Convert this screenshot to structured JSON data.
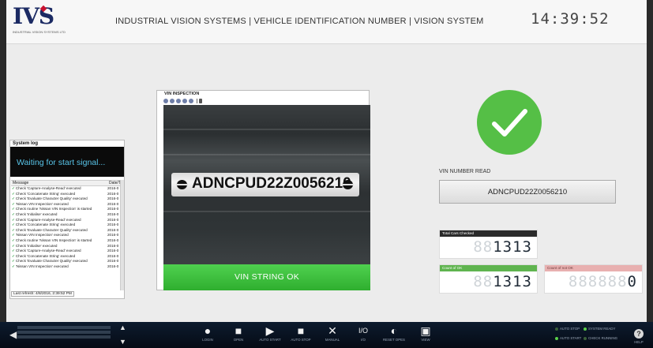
{
  "header": {
    "logo_text": "IVS",
    "logo_subtitle": "INDUSTRIAL VISION SYSTEMS LTD",
    "title": "INDUSTRIAL VISION SYSTEMS | VEHICLE IDENTIFICATION NUMBER | VISION SYSTEM",
    "clock": "14:39:52"
  },
  "system_log": {
    "title": "System log",
    "status": "Waiting for start signal...",
    "columns": [
      "Message",
      "Date/T"
    ],
    "rows": [
      {
        "msg": "Check 'Capture-Analyse-Read' executed",
        "date": "2016-0"
      },
      {
        "msg": "Check 'Concatenate String' executed",
        "date": "2016-0"
      },
      {
        "msg": "Check 'Evaluate Character Quality' executed",
        "date": "2016-0"
      },
      {
        "msg": "'Nissan VIN Inspection' executed",
        "date": "2016-0"
      },
      {
        "msg": "Check routine 'Nissan VIN Inspection' is started",
        "date": "2016-0"
      },
      {
        "msg": "Check 'Initialise' executed",
        "date": "2016-0"
      },
      {
        "msg": "Check 'Capture-Analyse-Read' executed",
        "date": "2016-0"
      },
      {
        "msg": "Check 'Concatenate String' executed",
        "date": "2016-0"
      },
      {
        "msg": "Check 'Evaluate Character Quality' executed",
        "date": "2016-0"
      },
      {
        "msg": "'Nissan VIN Inspection' executed",
        "date": "2016-0"
      },
      {
        "msg": "Check routine 'Nissan VIN Inspection' is started",
        "date": "2016-0"
      },
      {
        "msg": "Check 'Initialise' executed",
        "date": "2016-0"
      },
      {
        "msg": "Check 'Capture-Analyse-Read' executed",
        "date": "2016-0"
      },
      {
        "msg": "Check 'Concatenate String' executed",
        "date": "2016-0"
      },
      {
        "msg": "Check 'Evaluate Character Quality' executed",
        "date": "2016-0"
      },
      {
        "msg": "'Nissan VIN Inspection' executed",
        "date": "2016-0"
      }
    ],
    "footer": "Last refresh: 4/8/2016, 2:39:52 PM"
  },
  "vin_inspection": {
    "title": "VIN INSPECTION",
    "plate_text": "ADNCPUD22Z0056210",
    "result": "VIN STRING OK"
  },
  "vin_read": {
    "label": "VIN NUMBER READ",
    "value": "ADNCPUD22Z0056210"
  },
  "counters": {
    "total": {
      "label": "Total Cars Checked",
      "ghost": "88",
      "value": "1313",
      "color": "#2b2b2b"
    },
    "ok": {
      "label": "Count of OK",
      "ghost": "88",
      "value": "1313",
      "color": "#5fb44f"
    },
    "not_ok": {
      "label": "Count of not OK",
      "ghost": "888888",
      "value": "0",
      "color": "#e8b0b0"
    }
  },
  "taskbar": {
    "items": [
      {
        "icon": "user-icon",
        "label": "LOGIN"
      },
      {
        "icon": "folder-icon",
        "label": "OPEN"
      },
      {
        "icon": "auto-start-icon",
        "label": "AUTO START"
      },
      {
        "icon": "stop-icon",
        "label": "AUTO STOP"
      },
      {
        "icon": "wrench-icon",
        "label": "MANUAL"
      },
      {
        "icon": "io-icon",
        "label": "I/O"
      },
      {
        "icon": "reset-icon",
        "label": "RESET OPES"
      },
      {
        "icon": "view-icon",
        "label": "VIEW"
      }
    ],
    "status_lights": {
      "auto_stop": "AUTO STOP",
      "system_ready": "SYSTEM READY",
      "auto_start": "AUTO START",
      "check_running": "CHECK RUNNING"
    },
    "help": "HELP"
  },
  "colors": {
    "accent_green": "#55bf46",
    "result_green": "#3cc23c",
    "status_text": "#58c4e8",
    "title_navy": "#1b2a63"
  }
}
